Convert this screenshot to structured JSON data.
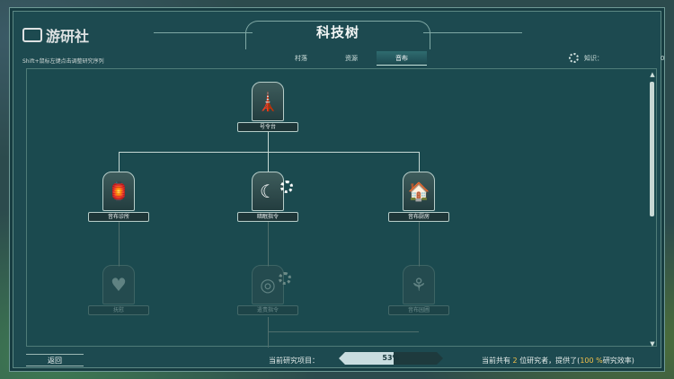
{
  "header": {
    "title": "科技树",
    "watermark": "游研社",
    "watermark_sub": "Shift+鼠标左键点击调整研究序列",
    "tabs": [
      {
        "label": "村落",
        "active": false
      },
      {
        "label": "资源",
        "active": false
      },
      {
        "label": "音布",
        "active": true
      }
    ],
    "knowledge_label": "知识：",
    "knowledge_value": "0"
  },
  "tree": {
    "nodes": [
      {
        "label": "号令台",
        "icon": "horn-tower-icon",
        "unlocked": true
      },
      {
        "label": "音布诊所",
        "icon": "bell-clinic-icon",
        "unlocked": true
      },
      {
        "label": "暗眠指令",
        "icon": "moon-icon",
        "unlocked": true,
        "researching": true
      },
      {
        "label": "音布厨房",
        "icon": "kitchen-icon",
        "unlocked": true
      },
      {
        "label": "抚慰",
        "icon": "heart-hands-icon",
        "unlocked": false
      },
      {
        "label": "遣责指令",
        "icon": "coin-icon",
        "unlocked": false
      },
      {
        "label": "音布园圃",
        "icon": "sprout-icon",
        "unlocked": false
      }
    ]
  },
  "footer": {
    "back_label": "返回",
    "current_label": "当前研究项目：",
    "progress_text": "53%",
    "progress_value": 0.53,
    "research_info_pre": "当前共有",
    "researchers": "2",
    "research_info_mid": "位研究者，提供了(",
    "efficiency": "100 %",
    "research_info_post": "研究效率)"
  },
  "colors": {
    "panel": "#1d4a50",
    "highlight": "#f1c04a",
    "line": "#c6d8d4"
  }
}
